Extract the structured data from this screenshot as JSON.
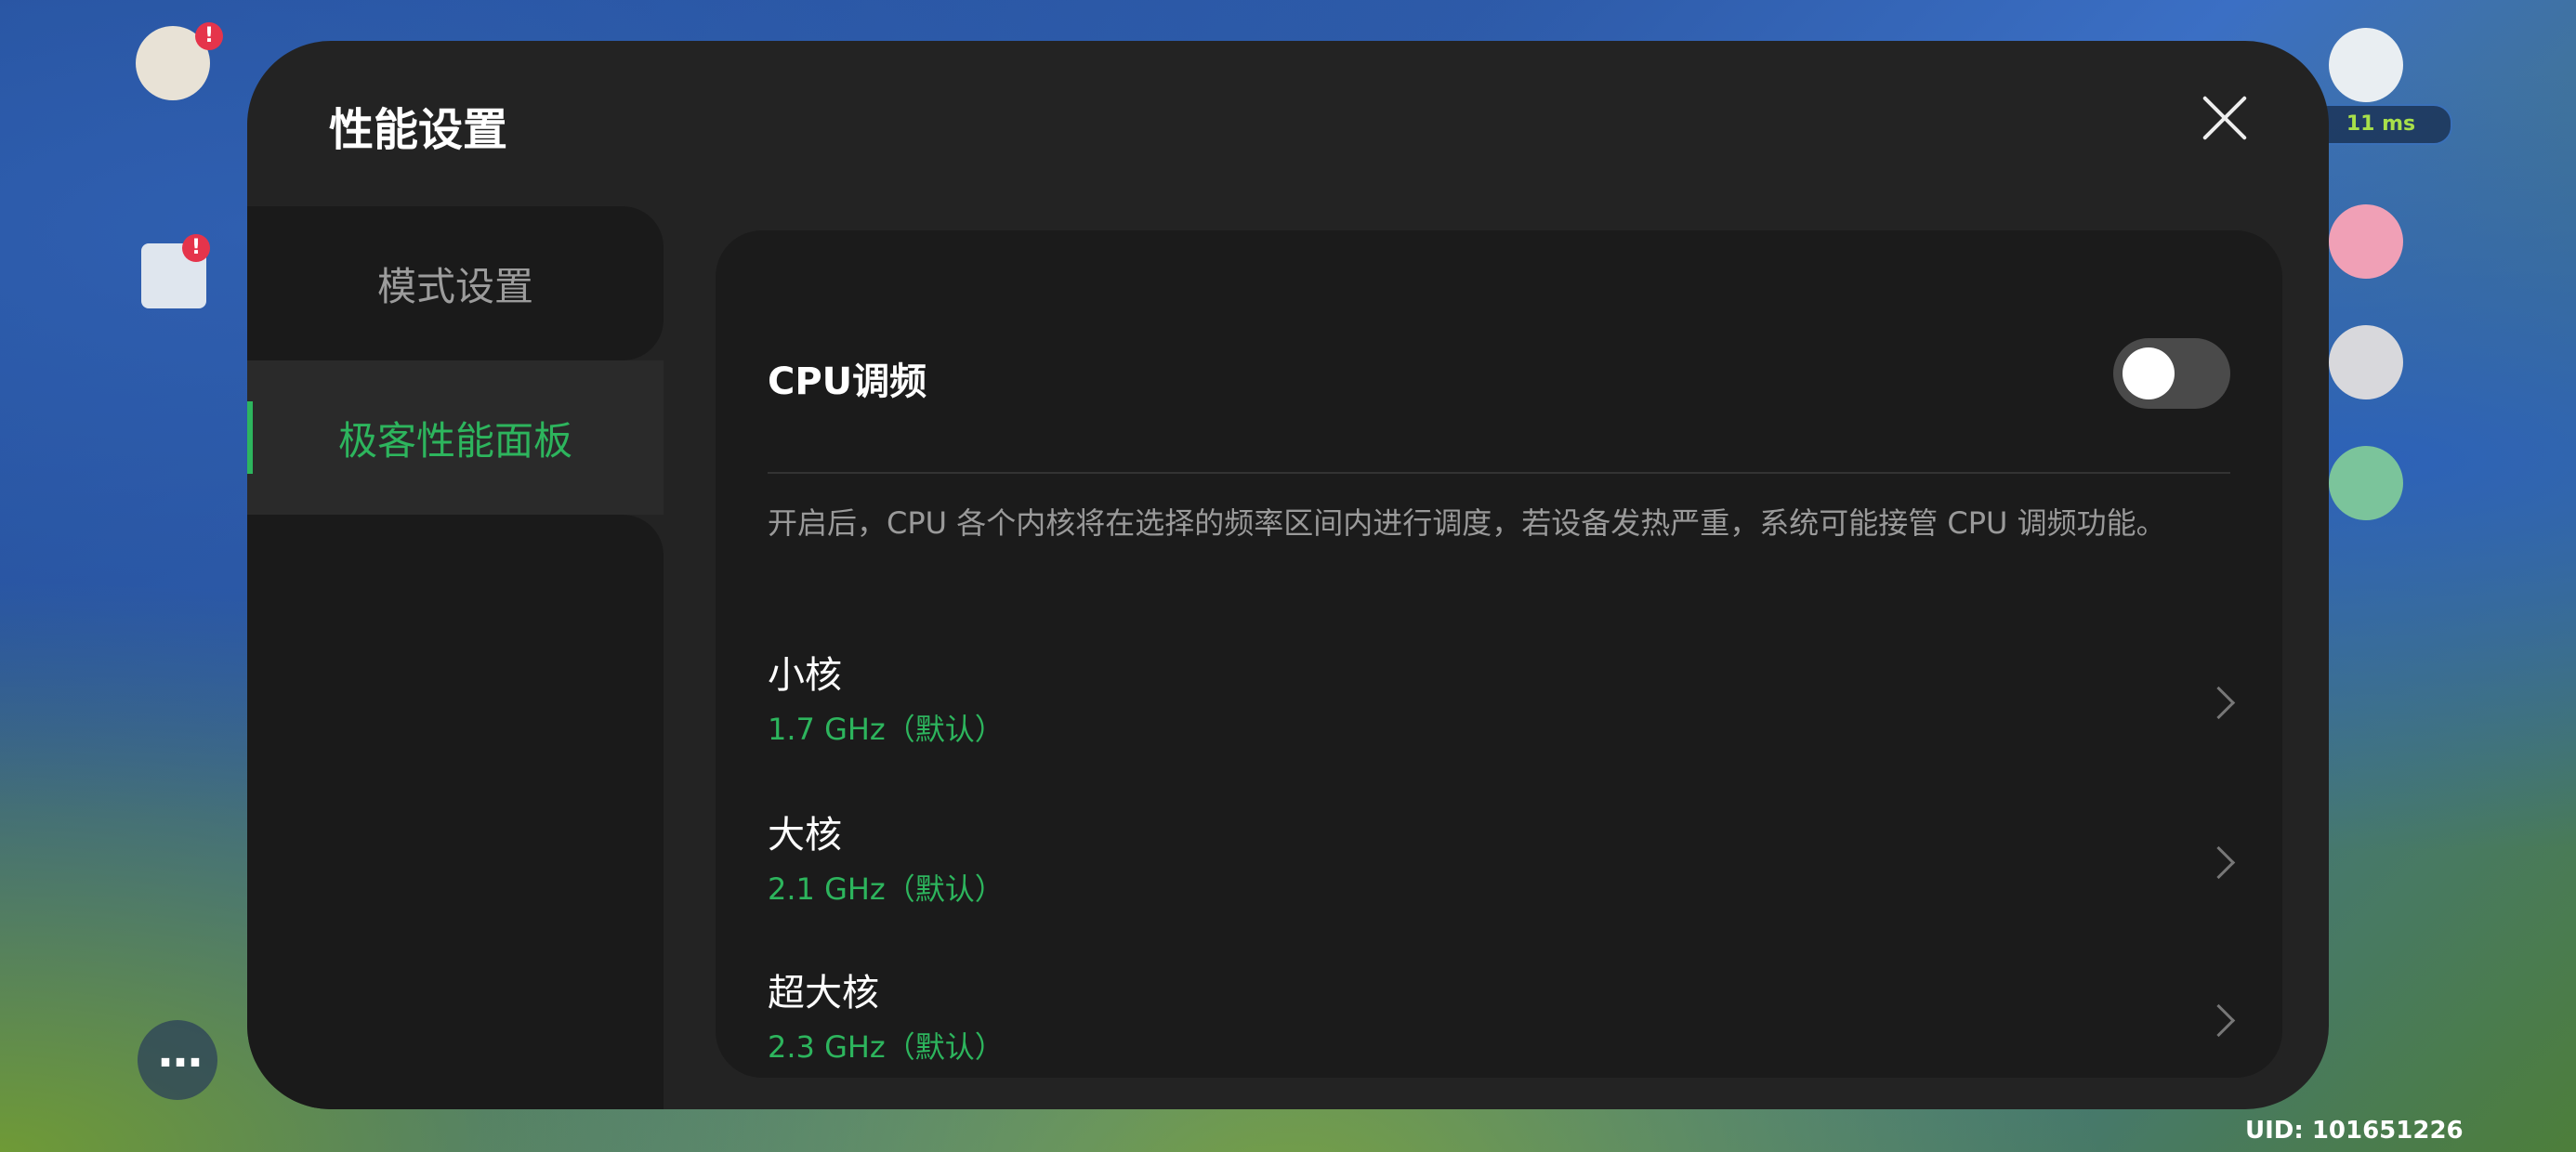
{
  "modal": {
    "title": "性能设置",
    "close_icon": "close-icon"
  },
  "sidebar": {
    "items": [
      {
        "label": "模式设置",
        "active": false
      },
      {
        "label": "极客性能面板",
        "active": true
      }
    ]
  },
  "content": {
    "cpu_toggle_label": "CPU调频",
    "cpu_toggle_on": false,
    "description": "开启后，CPU 各个内核将在选择的频率区间内进行调度，若设备发热严重，系统可能接管 CPU 调频功能。",
    "cores": [
      {
        "name": "小核",
        "value": "1.7 GHz（默认）"
      },
      {
        "name": "大核",
        "value": "2.1 GHz（默认）"
      },
      {
        "name": "超大核",
        "value": "2.3 GHz（默认）"
      }
    ]
  },
  "game_overlay": {
    "ping": "11 ms",
    "uid": "UID: 101651226"
  },
  "colors": {
    "accent": "#2db55d",
    "modal_bg": "#232323",
    "panel_bg": "#1b1b1b"
  }
}
